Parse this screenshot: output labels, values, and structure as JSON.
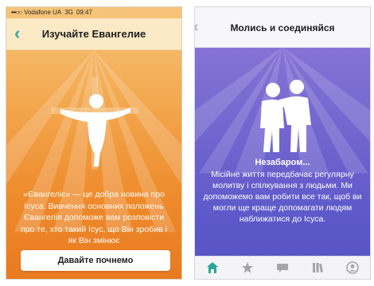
{
  "left_screen": {
    "status_bar": {
      "signal": "•••○○",
      "carrier": "Vodafone UA",
      "network": "3G",
      "time": "09:47"
    },
    "title": "Изучайте Евангелие",
    "body_text": "«Євангеліє» — це добра новина про Ісуса. Вивчення основних положень Євангелія допоможе вам розповісти про те, хто такий Ісус, що Він зробив і як Він змінює",
    "start_button_label": "Давайте почнемо",
    "colors": {
      "accent": "#2aa89a",
      "background": "#ee8b2c",
      "header": "#fce9c6"
    },
    "icons": {
      "back": "chevron-left-icon",
      "figure": "crucifix-icon"
    }
  },
  "right_screen": {
    "title": "Молись и соединяйся",
    "soon_heading": "Незабаром...",
    "body_text": "Місійне життя передбачає регулярну молитву і спілкування з людьми. Ми допоможемо вам робити все так, щоб ви могли ще краще допомагати людям наближатися до Ісуса.",
    "colors": {
      "background": "#6f63cf",
      "tab_active": "#2aa89a",
      "tab_inactive": "#a5a5a8"
    },
    "tabs": [
      {
        "icon": "home-icon",
        "active": true
      },
      {
        "icon": "star-icon",
        "active": false
      },
      {
        "icon": "chat-icon",
        "active": false
      },
      {
        "icon": "library-icon",
        "active": false
      },
      {
        "icon": "profile-icon",
        "active": false
      }
    ]
  }
}
